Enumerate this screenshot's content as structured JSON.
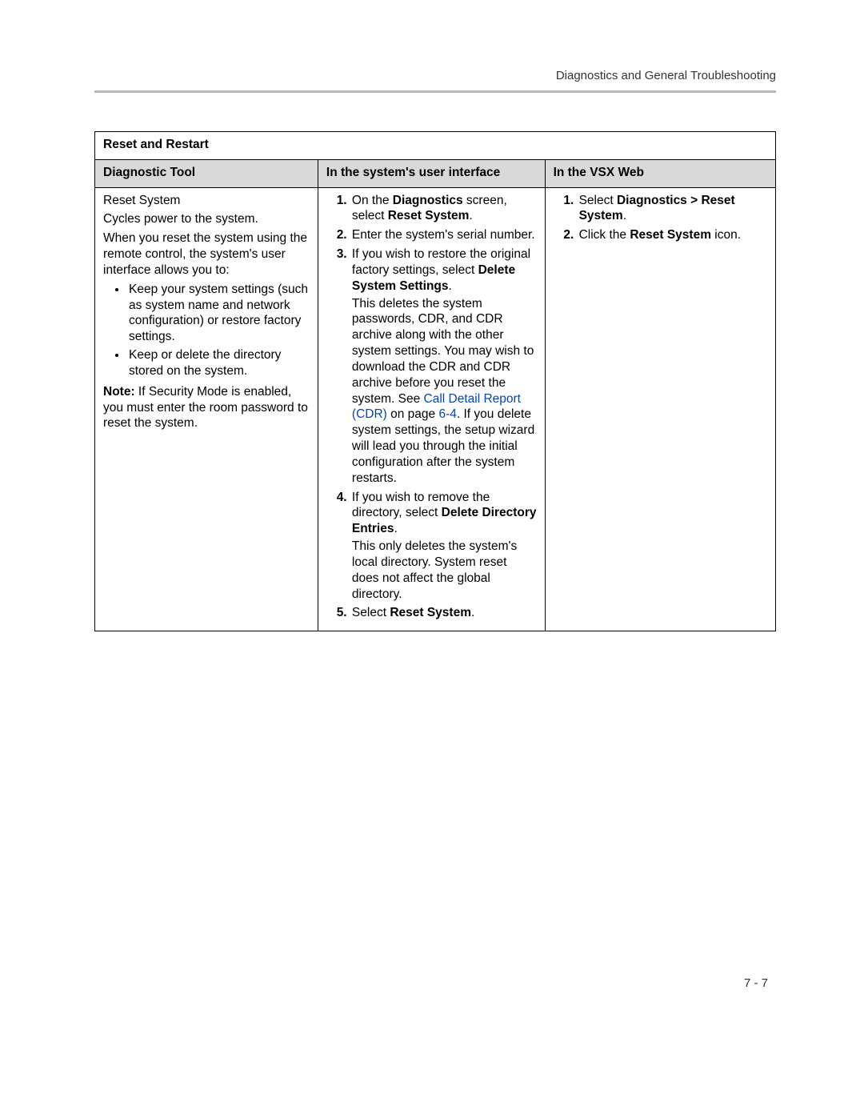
{
  "header": "Diagnostics and General Troubleshooting",
  "page_number": "7 - 7",
  "table": {
    "title": "Reset and Restart",
    "headers": {
      "c1": "Diagnostic Tool",
      "c2": "In the system's user interface",
      "c3": "In the VSX Web"
    },
    "col1": {
      "p1": "Reset System",
      "p2": "Cycles power to the system.",
      "p3": "When you reset the system using the remote control, the system's user interface allows you to:",
      "b1": "Keep your system settings (such as system name and network configuration) or restore factory settings.",
      "b2": "Keep or delete the directory stored on the system.",
      "note_label": "Note:",
      "note": " If Security Mode is enabled, you must enter the room password to reset the system."
    },
    "col2": {
      "s1a": "On the ",
      "s1b": "Diagnostics",
      "s1c": " screen, select ",
      "s1d": "Reset System",
      "s1e": ".",
      "s2": "Enter the system's serial number.",
      "s3a": "If you wish to restore the original factory settings, select ",
      "s3b": "Delete System Settings",
      "s3c": ".",
      "s3sub_a": "This deletes the system passwords, CDR, and CDR archive along with the other system settings. You may wish to download the CDR and CDR archive before you reset the system. See ",
      "s3sub_link": "Call Detail Report (CDR)",
      "s3sub_b": " on page ",
      "s3sub_pg": "6-4",
      "s3sub_c": ". If you delete system settings, the setup wizard will lead you through the initial configuration after the system restarts.",
      "s4a": "If you wish to remove the directory, select ",
      "s4b": "Delete Directory Entries",
      "s4c": ".",
      "s4sub": "This only deletes the system's local directory. System reset does not affect the global directory.",
      "s5a": "Select ",
      "s5b": "Reset System",
      "s5c": "."
    },
    "col3": {
      "s1a": "Select ",
      "s1b": "Diagnostics > Reset System",
      "s1c": ".",
      "s2a": "Click the ",
      "s2b": "Reset System",
      "s2c": " icon."
    }
  }
}
